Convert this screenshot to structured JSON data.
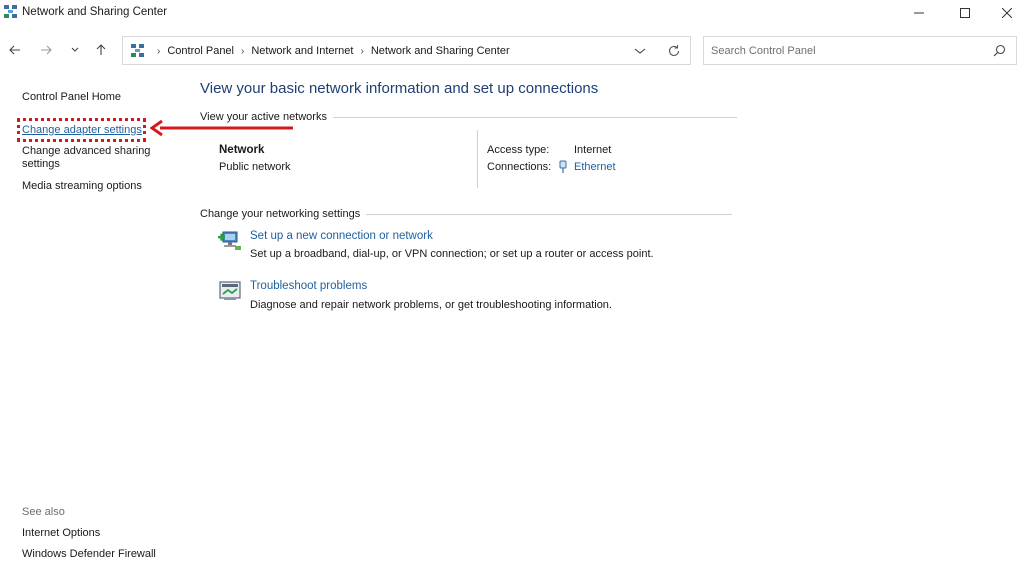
{
  "window": {
    "title": "Network and Sharing Center",
    "controls": {
      "minimize": "minimize-icon",
      "maximize": "maximize-icon",
      "close": "close-icon"
    }
  },
  "address_bar": {
    "breadcrumbs": [
      "Control Panel",
      "Network and Internet",
      "Network and Sharing Center"
    ]
  },
  "search": {
    "placeholder": "Search Control Panel"
  },
  "left_pane": {
    "home": "Control Panel Home",
    "links": [
      "Change adapter settings",
      "Change advanced sharing settings",
      "Media streaming options"
    ],
    "see_also_label": "See also",
    "see_also": [
      "Internet Options",
      "Windows Defender Firewall"
    ]
  },
  "annotation": {
    "highlight_color": "#d11b1b"
  },
  "main": {
    "title": "View your basic network information and set up connections",
    "active_networks_label": "View your active networks",
    "network": {
      "name": "Network",
      "category": "Public network",
      "access_type_label": "Access type:",
      "access_type": "Internet",
      "connections_label": "Connections:",
      "connection": "Ethernet"
    },
    "settings_label": "Change your networking settings",
    "tasks": [
      {
        "link": "Set up a new connection or network",
        "description": "Set up a broadband, dial-up, or VPN connection; or set up a router or access point."
      },
      {
        "link": "Troubleshoot problems",
        "description": "Diagnose and repair network problems, or get troubleshooting information."
      }
    ]
  },
  "colors": {
    "link": "#1f5f9e",
    "title": "#1e3f74",
    "highlight": "#d11b1b"
  }
}
